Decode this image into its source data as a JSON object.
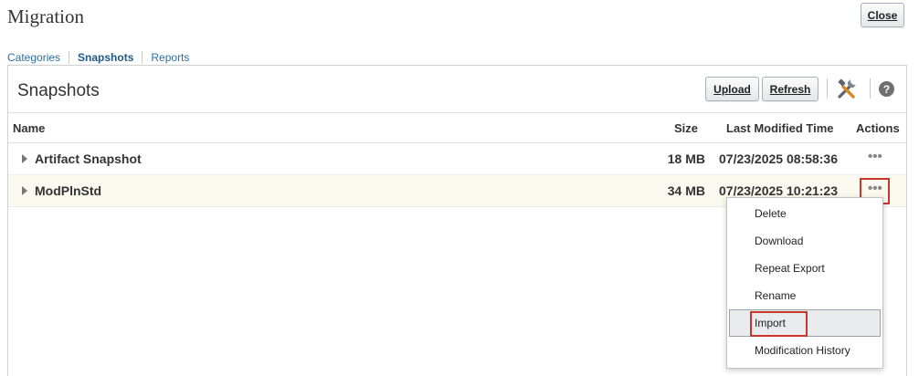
{
  "header": {
    "title": "Migration",
    "close_label": "Close"
  },
  "tabs": [
    {
      "label": "Categories",
      "active": false
    },
    {
      "label": "Snapshots",
      "active": true
    },
    {
      "label": "Reports",
      "active": false
    }
  ],
  "panel": {
    "title": "Snapshots",
    "upload_label": "Upload",
    "refresh_label": "Refresh",
    "help_symbol": "?"
  },
  "table": {
    "columns": [
      "Name",
      "Size",
      "Last Modified Time",
      "Actions"
    ],
    "rows": [
      {
        "name": "Artifact Snapshot",
        "size": "18 MB",
        "modified": "07/23/2025 08:58:36",
        "actions": "•••"
      },
      {
        "name": "ModPlnStd",
        "size": "34 MB",
        "modified": "07/23/2025 10:21:23",
        "actions": "•••"
      }
    ]
  },
  "context_menu": {
    "items": [
      "Delete",
      "Download",
      "Repeat Export",
      "Rename",
      "Import",
      "Modification History"
    ],
    "highlighted": "Import"
  },
  "colors": {
    "link": "#2e6f9e",
    "highlight_box": "#c9362a",
    "selected_row": "#f9f9ef"
  },
  "icons": {
    "tools": "tools-icon",
    "help": "help-icon",
    "expand": "disclosure-triangle-icon",
    "actions": "ellipsis-icon"
  }
}
